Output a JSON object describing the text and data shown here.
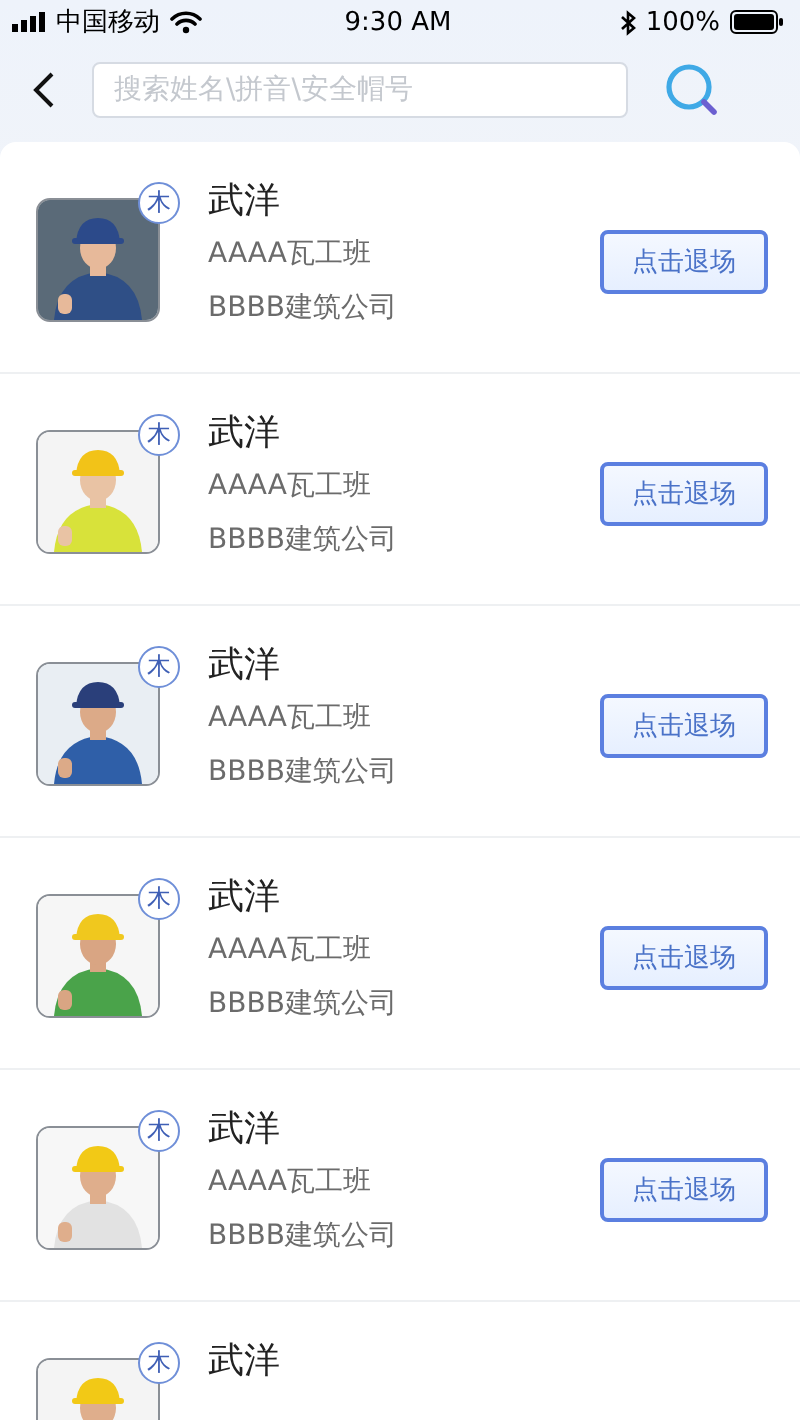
{
  "status_bar": {
    "carrier": "中国移动",
    "time": "9:30 AM",
    "battery": "100%"
  },
  "search": {
    "placeholder": "搜索姓名\\拼音\\安全帽号"
  },
  "workers": [
    {
      "name": "武洋",
      "badge": "木",
      "team": "AAAA瓦工班",
      "company": "BBBB建筑公司",
      "button": "点击退场",
      "kind": "full"
    },
    {
      "name": "武洋",
      "badge": "木",
      "team": "AAAA瓦工班",
      "company": "BBBB建筑公司",
      "button": "点击退场",
      "kind": "full"
    },
    {
      "name": "武洋",
      "badge": "木",
      "team": "AAAA瓦工班",
      "company": "BBBB建筑公司",
      "button": "点击退场",
      "kind": "full"
    },
    {
      "name": "武洋",
      "badge": "木",
      "team": "AAAA瓦工班",
      "company": "BBBB建筑公司",
      "button": "点击退场",
      "kind": "full"
    },
    {
      "name": "武洋",
      "badge": "木",
      "team": "AAAA瓦工班",
      "company": "BBBB建筑公司",
      "button": "点击退场",
      "kind": "full"
    },
    {
      "name": "武洋",
      "badge": "木",
      "kind": "partial"
    }
  ]
}
